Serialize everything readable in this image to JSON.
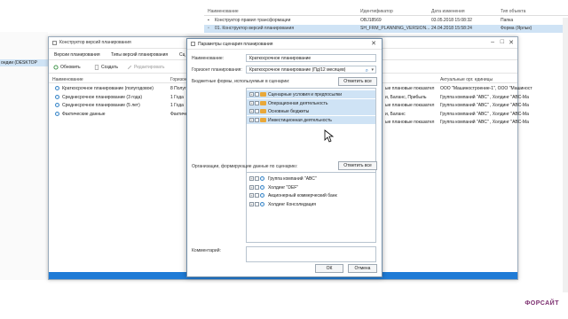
{
  "bg": {
    "columns": {
      "name": "Наименование",
      "id": "Идентификатор",
      "date": "Дата изменения",
      "type": "Тип объекта"
    },
    "rows": [
      {
        "name": "Конструктор правил трансформации",
        "id": "OBJ18569",
        "date": "03.05.2018 15:08:32",
        "type": "Папка"
      },
      {
        "name": "01. Конструктор версий планирования",
        "id": "SH_FRM_PLANNING_VERSION...",
        "date": "24.04.2018 15:58:24",
        "type": "Форма (Ярлык)"
      }
    ],
    "left_selected": "ондии (DESKTOP"
  },
  "mid": {
    "title": "Конструктор версий планирования",
    "tabs": [
      "Версии планирования",
      "Типы версий планирования",
      "Сц"
    ],
    "toolbar": {
      "refresh": "Обновить",
      "create": "Создать",
      "edit": "Редактировать"
    },
    "columns": {
      "name": "Наименование",
      "horizon": "Горизон"
    },
    "items": [
      {
        "name": "Краткосрочное планирование (полугодовое)",
        "extra": "8 Полуг"
      },
      {
        "name": "Среднесрочное планирование (3 года)",
        "extra": "1 Года"
      },
      {
        "name": "Среднесрочное планирование (5 лет)",
        "extra": "1 Года"
      },
      {
        "name": "Фактические данные",
        "extra": "Фактиче"
      }
    ],
    "right_cols": {
      "actual": "Актуальные орг. единицы"
    },
    "right_rows": [
      {
        "a": "ые плановые показател",
        "b": "ООО \"Машиностроение-1\", ООО \"Машиност"
      },
      {
        "a": "и, Баланс, Прибыль",
        "b": "Группа компаний \"АВС\" , Холдинг \"АВС-Ма"
      },
      {
        "a": "ые плановые показател",
        "b": "Группа компаний \"АВС\" , Холдинг \"АВС-Ма"
      },
      {
        "a": "и, Баланс",
        "b": "Группа компаний \"АВС\" , Холдинг \"АВС-Ма"
      },
      {
        "a": "ые плановые показател",
        "b": "Группа компаний \"АВС\" , Холдинг \"АВС-Ма"
      }
    ]
  },
  "dialog": {
    "title": "Параметры сценария планирования",
    "name_label": "Наименование:",
    "name_value": "Краткосрочное планирование",
    "horizon_label": "Горизонт планирования:",
    "horizon_value": "Краткосрочное планирование (Пд/12 месяцев)",
    "forms_label": "Бюджетные формы, используемые в сценарии:",
    "mark_all": "Отметить все",
    "forms": [
      "Сценарные условия и предпосылки",
      "Операционная деятельность",
      "Основные бюджеты",
      "Инвестиционная деятельность"
    ],
    "orgs_label": "Организации, формирующие данные по сценарию:",
    "orgs": [
      "Группа компаний \"АВС\"",
      "Холдинг \"DEF\"",
      "Акционерный коммерческий банк",
      "Холдинг Консолидация"
    ],
    "comment_label": "Комментарий:",
    "ok": "ОК",
    "cancel": "Отмена"
  },
  "brand": "ФОРСАЙТ"
}
